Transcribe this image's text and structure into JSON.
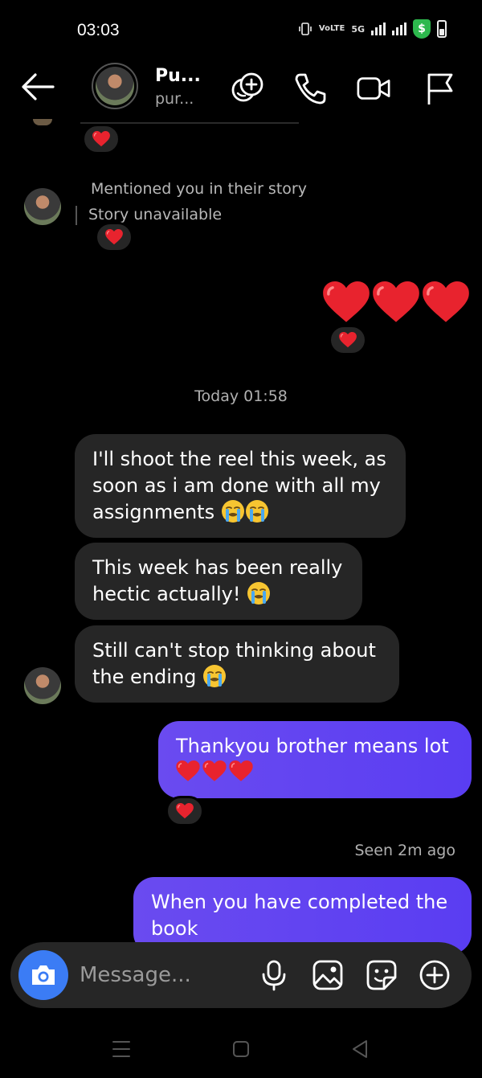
{
  "status_bar": {
    "time": "03:03",
    "network": "5G",
    "volte": "VoLTE",
    "shield_symbol": "$"
  },
  "header": {
    "contact_name": "Pu...",
    "contact_username": "pur...",
    "icons": [
      "back-arrow-icon",
      "add-effect-icon",
      "phone-icon",
      "video-camera-icon",
      "flag-icon"
    ]
  },
  "conversation": {
    "story_mention": "Mentioned you in their story",
    "story_status": "Story unavailable",
    "sent_hearts": "❤️❤️❤️",
    "timestamp": "Today 01:58",
    "incoming": [
      {
        "text": "I'll shoot the reel this week, as soon as i am done with all my assignments",
        "emoji": "😭😭"
      },
      {
        "text": "This week has been really hectic actually!",
        "emoji": "😭"
      },
      {
        "text": "Still can't stop thinking about the ending",
        "emoji": "😭"
      }
    ],
    "outgoing": [
      {
        "text": "Thankyou brother means lot",
        "emoji": "❤️❤️❤️"
      },
      {
        "text": "When you have completed the book"
      }
    ],
    "seen": "Seen 2m ago",
    "reaction_emoji": "❤️"
  },
  "composer": {
    "placeholder": "Message...",
    "icons": [
      "camera-icon",
      "microphone-icon",
      "gallery-icon",
      "sticker-icon",
      "plus-circle-icon"
    ]
  },
  "colors": {
    "background": "#000000",
    "incoming_bubble": "#262626",
    "outgoing_bubble": "#5f43f2",
    "camera_button": "#3b7cf5",
    "heart": "#e8232e"
  }
}
